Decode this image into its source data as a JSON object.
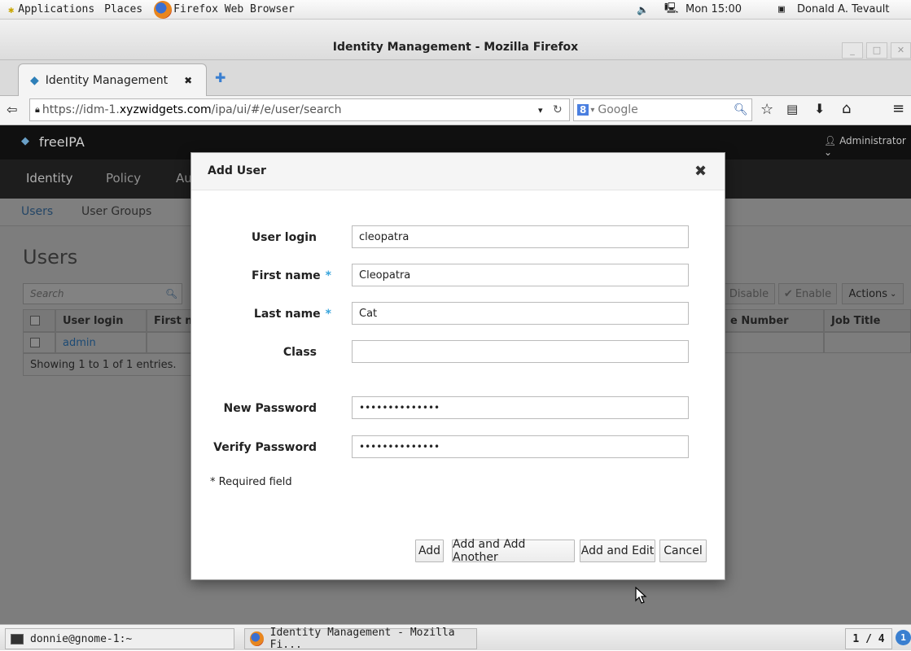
{
  "panel": {
    "applications": "Applications",
    "places": "Places",
    "active_app": "Firefox Web Browser",
    "clock": "Mon 15:00",
    "user": "Donald A. Tevault"
  },
  "window": {
    "title": "Identity Management - Mozilla Firefox"
  },
  "tabs": [
    {
      "label": "Identity Management"
    }
  ],
  "navbar": {
    "url_prefix": "https://idm-1.",
    "url_domain": "xyzwidgets.com",
    "url_path": "/ipa/ui/#/e/user/search",
    "search_engine": "Google"
  },
  "app": {
    "brand": "freeIPA",
    "user_menu": "Administrator",
    "nav": [
      "Identity",
      "Policy",
      "Au"
    ],
    "subnav": [
      "Users",
      "User Groups"
    ],
    "page_title": "Users",
    "search_placeholder": "Search",
    "table_headers": {
      "user_login": "User login",
      "first_name": "First n",
      "phone": "e Number",
      "job_title": "Job Title"
    },
    "rows": [
      {
        "user_login": "admin"
      }
    ],
    "footer": "Showing 1 to 1 of 1 entries.",
    "actions": {
      "disable": "Disable",
      "enable": "Enable",
      "actions": "Actions"
    }
  },
  "dialog": {
    "title": "Add User",
    "fields": {
      "user_login": {
        "label": "User login",
        "value": "cleopatra"
      },
      "first_name": {
        "label": "First name",
        "value": "Cleopatra",
        "required": "*"
      },
      "last_name": {
        "label": "Last name",
        "value": "Cat",
        "required": "*"
      },
      "class": {
        "label": "Class",
        "value": ""
      },
      "new_password": {
        "label": "New Password",
        "value": "••••••••••••••"
      },
      "verify_password": {
        "label": "Verify Password",
        "value": "••••••••••••••"
      }
    },
    "required_note": "* Required field",
    "buttons": {
      "add": "Add",
      "add_another": "Add and Add Another",
      "add_edit": "Add and Edit",
      "cancel": "Cancel"
    }
  },
  "taskbar": {
    "terminal": "donnie@gnome-1:~",
    "firefox": "Identity Management - Mozilla Fi...",
    "workspace": "1 / 4"
  },
  "colors": {
    "accent": "#39a5dc",
    "app_header": "#101010",
    "link": "#0088ce"
  }
}
